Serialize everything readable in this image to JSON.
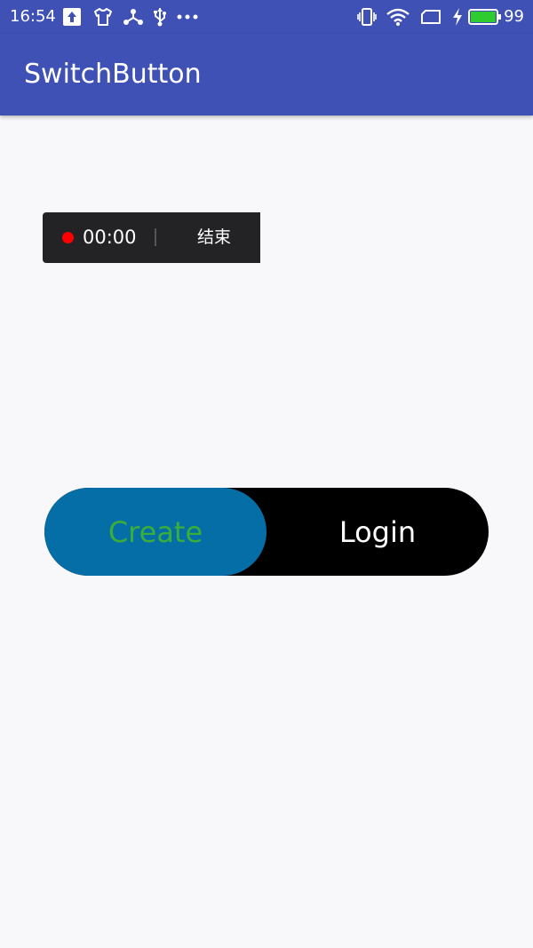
{
  "status_bar": {
    "time": "16:54",
    "left_icons": [
      "upload-icon",
      "tshirt-icon",
      "share-hub-icon",
      "usb-icon",
      "more-dots-icon"
    ],
    "right_icons": [
      "vibrate-icon",
      "wifi-icon",
      "sim-icon",
      "charging-bolt-icon",
      "battery-icon"
    ],
    "battery_level": "99",
    "battery_fraction": 0.99,
    "colors": {
      "bar": "#3f51b5",
      "battery_fill": "#2ecc2e"
    }
  },
  "app_bar": {
    "title": "SwitchButton",
    "color": "#3f51b5"
  },
  "recording_overlay": {
    "time": "00:00",
    "end_label": "结束",
    "colors": {
      "background": "#232225",
      "dot": "#ff0000"
    }
  },
  "switch_button": {
    "options": [
      "Create",
      "Login"
    ],
    "selected": "Create",
    "colors": {
      "track": "#000000",
      "knob": "#066ea6",
      "selected_text": "#3aae3a",
      "unselected_text": "#ffffff"
    }
  }
}
